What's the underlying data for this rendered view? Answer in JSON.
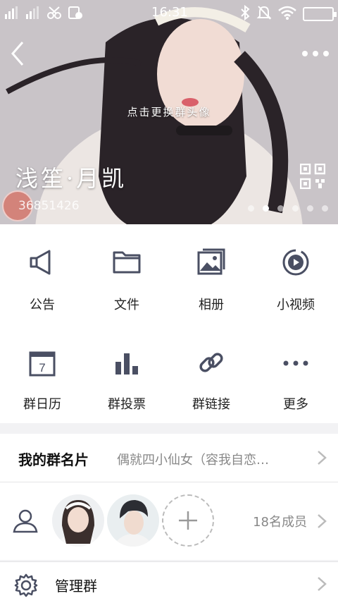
{
  "status": {
    "time": "16:31"
  },
  "header": {
    "change_avatar_hint": "点击更换群头像",
    "group_name": "浅笙·月凯",
    "group_id": "36851426",
    "page_dots": 6,
    "active_dot": 2
  },
  "features": [
    {
      "label": "公告",
      "icon": "announcement-icon"
    },
    {
      "label": "文件",
      "icon": "folder-icon"
    },
    {
      "label": "相册",
      "icon": "photo-album-icon"
    },
    {
      "label": "小视频",
      "icon": "video-icon"
    },
    {
      "label": "群日历",
      "icon": "calendar-icon"
    },
    {
      "label": "群投票",
      "icon": "vote-icon"
    },
    {
      "label": "群链接",
      "icon": "link-icon"
    },
    {
      "label": "更多",
      "icon": "more-icon"
    }
  ],
  "group_card": {
    "label": "我的群名片",
    "value": "偶就四小仙女（容我自恋…"
  },
  "members": {
    "count": "18名成员"
  },
  "manage": {
    "label": "管理群"
  },
  "colors": {
    "icon_gray": "#4a4f63",
    "accent_badge": "#d66e60"
  }
}
